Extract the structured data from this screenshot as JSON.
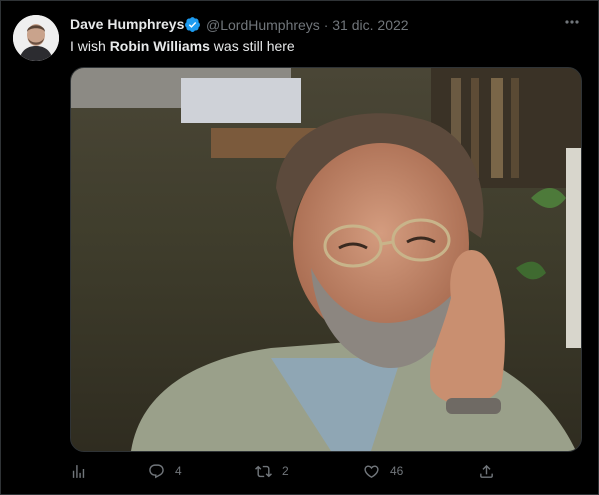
{
  "tweet": {
    "author_name": "Dave Humphreys",
    "handle": "@LordHumphreys",
    "separator": "·",
    "date": "31 dic. 2022",
    "text_before": "I wish ",
    "text_bold": "Robin Williams",
    "text_after": " was still here"
  },
  "media": {
    "image_alt": "Photo of a smiling bearded man with glasses resting his cheek on his hand"
  },
  "actions": {
    "analytics_icon": "analytics-icon",
    "reply_count": "4",
    "retweet_count": "2",
    "like_count": "46",
    "share_icon": "share-icon"
  },
  "colors": {
    "background": "#000000",
    "text": "#e7e9ea",
    "muted": "#71767b",
    "verified": "#1d9bf0",
    "border": "#2f3336"
  }
}
